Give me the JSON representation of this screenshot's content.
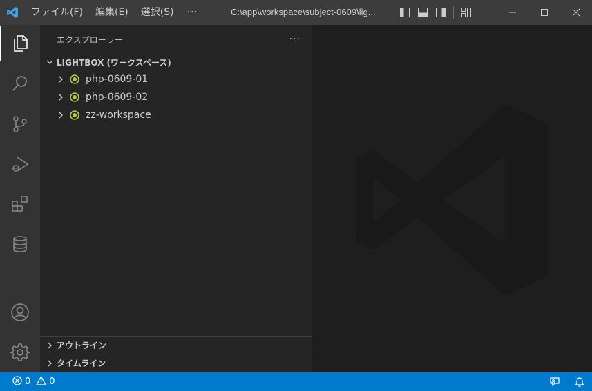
{
  "titlebar": {
    "menu": [
      "ファイル(F)",
      "編集(E)",
      "選択(S)"
    ],
    "more_label": "···",
    "title": "C:\\app\\workspace\\subject-0609\\lig..."
  },
  "sidebar": {
    "title": "エクスプローラー",
    "more_label": "···",
    "workspace": "LIGHTBOX (ワークスペース)",
    "folders": [
      {
        "label": "php-0609-01"
      },
      {
        "label": "php-0609-02"
      },
      {
        "label": "zz-workspace"
      }
    ],
    "outline": "アウトライン",
    "timeline": "タイムライン"
  },
  "statusbar": {
    "errors": "0",
    "warnings": "0"
  },
  "colors": {
    "accent": "#007acc",
    "folder_dot": "#b7c842",
    "activity_bar": "#333333",
    "sidebar": "#252526",
    "editor": "#1e1e1e",
    "titlebar": "#3c3c3c"
  },
  "icons": {
    "activity": [
      "explorer-icon",
      "search-icon",
      "source-control-icon",
      "run-debug-icon",
      "extensions-icon",
      "database-icon",
      "account-icon",
      "settings-gear-icon"
    ],
    "status": [
      "error-icon",
      "warning-icon",
      "feedback-icon",
      "bell-icon"
    ]
  }
}
